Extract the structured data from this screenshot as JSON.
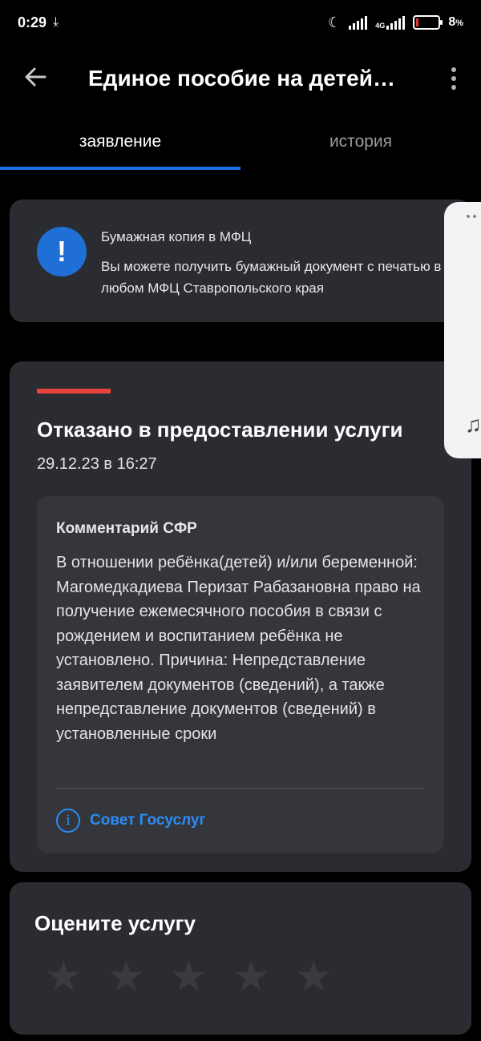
{
  "statusbar": {
    "time": "0:29",
    "battery": "8",
    "battery_pct": "%",
    "net": "4G"
  },
  "appbar": {
    "title": "Единое пособие на детей…"
  },
  "tabs": [
    {
      "label": "заявление",
      "active": true
    },
    {
      "label": "история",
      "active": false
    }
  ],
  "info_card": {
    "icon": "!",
    "title": "Бумажная копия в МФЦ",
    "text": "Вы можете получить бумажный документ с печатью в любом МФЦ Ставропольского края"
  },
  "status_card": {
    "title": "Отказано в предоставлении услуги",
    "date": "29.12.23 в 16:27",
    "status_color": "#e8423a",
    "comment": {
      "title": "Комментарий СФР",
      "text": "В отношении ребёнка(детей) и/или беременной: Магомедкадиева Перизат Рабазановна право на получение ежемесячного пособия в связи с рождением и воспитанием ребёнка не установлено. Причина: Непредставление заявителем документов (сведений), а также непредставление документов (сведений) в установленные сроки"
    },
    "advice": {
      "icon": "i",
      "label": "Совет Госуслуг"
    }
  },
  "rating": {
    "title": "Оцените услугу",
    "stars_total": 5,
    "stars_selected": 0
  },
  "colors": {
    "background": "#000000",
    "card": "#2b2c31",
    "accent": "#1d6fe6",
    "link": "#2a8cf4"
  }
}
